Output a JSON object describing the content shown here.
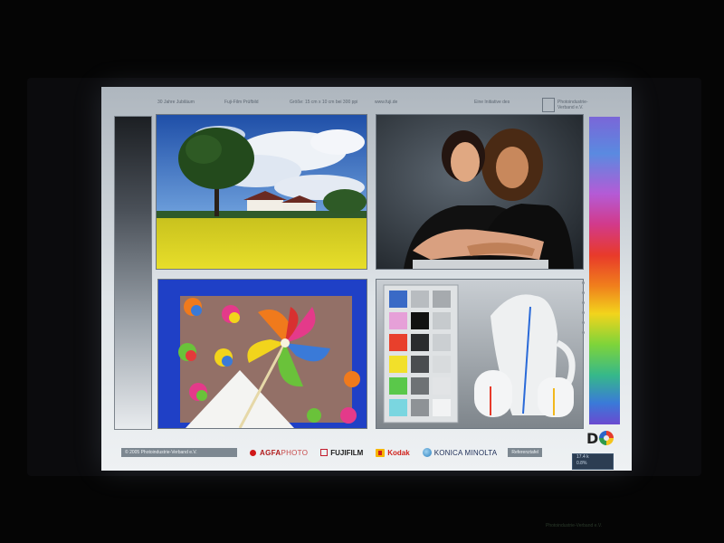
{
  "screen": {
    "top_text": [
      "30 Jahre Jubiläum",
      "Fuji-Film Prüfbild",
      "Größe: 15 cm x 10 cm bei 300 ppi",
      "www.fuji.de",
      "Eine Initiative des"
    ],
    "brand_corner": "Photoindustrie-Verband e.V.",
    "footer": {
      "copyright": "© 2005 Photoindustrie-Verband e.V.",
      "agfa_bold": "AGFA",
      "agfa_light": "PHOTO",
      "fujifilm": "FUJIFILM",
      "kodak": "Kodak",
      "konica": "KONICA MINOLTA",
      "reference": "Referenztafel"
    },
    "dq_logo": "D"
  },
  "osd": {
    "line1": "17.4 k",
    "line2": "0.8%"
  },
  "bottom_note": "Photoindustrie-Verband e.V.",
  "photos": [
    {
      "subject": "tree and farmhouse in rapeseed field"
    },
    {
      "subject": "two women portrait"
    },
    {
      "subject": "colorful pinwheels"
    },
    {
      "subject": "color chart and white ceramics"
    }
  ]
}
